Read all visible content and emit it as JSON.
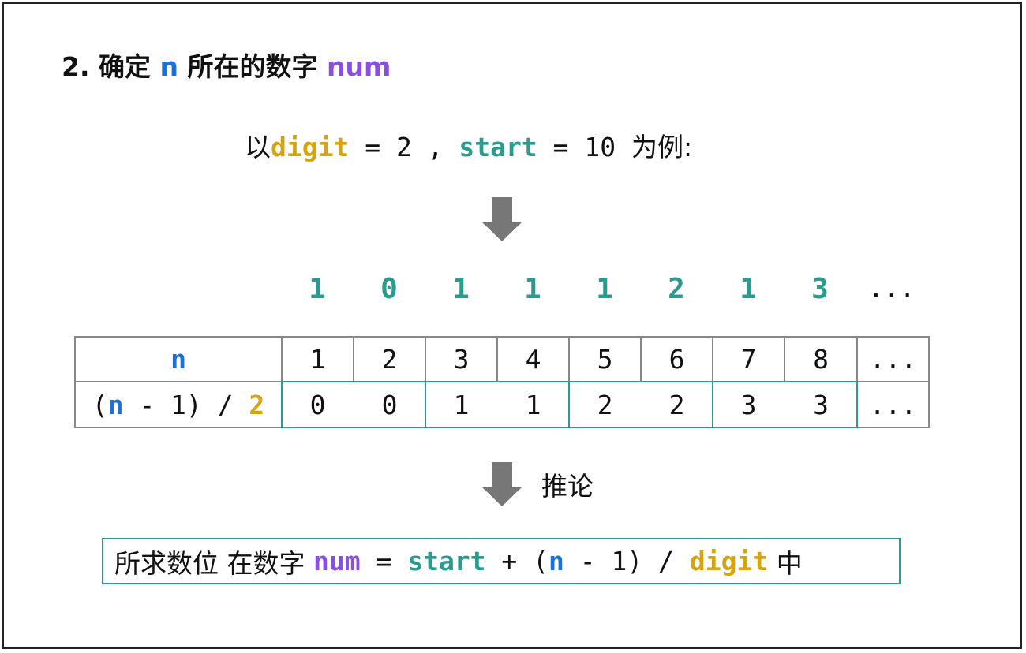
{
  "title": {
    "prefix": "2. 确定 ",
    "var_n": "n",
    "middle": " 所在的数字 ",
    "var_num": "num"
  },
  "example": {
    "prefix": "以",
    "digit_label": "digit",
    "digit_eq": " = 2 , ",
    "start_label": "start",
    "start_eq": " = 10 ",
    "suffix": "为例:"
  },
  "sequence": {
    "digits": [
      "1",
      "0",
      "1",
      "1",
      "1",
      "2",
      "1",
      "3"
    ],
    "ellipsis": "..."
  },
  "table": {
    "row1_header": "n",
    "row1_values": [
      "1",
      "2",
      "3",
      "4",
      "5",
      "6",
      "7",
      "8"
    ],
    "row2_header": {
      "open": "(",
      "n": "n",
      "mid": " - 1) / ",
      "two": "2"
    },
    "row2_values": [
      "0",
      "0",
      "1",
      "1",
      "2",
      "2",
      "3",
      "3"
    ],
    "ellipsis": "..."
  },
  "inference_label": "推论",
  "formula": {
    "prefix": "所求数位 在数字 ",
    "num": "num",
    "eq": " = ",
    "start": "start",
    "plus": " + (",
    "n": "n",
    "minus": " - 1) / ",
    "digit": "digit",
    "suffix": " 中"
  },
  "colors": {
    "n": "#1a72d9",
    "num": "#8a4fe0",
    "digit": "#d6a40e",
    "start": "#2d9a8e",
    "arrow": "#777777",
    "grid": "#888888"
  }
}
